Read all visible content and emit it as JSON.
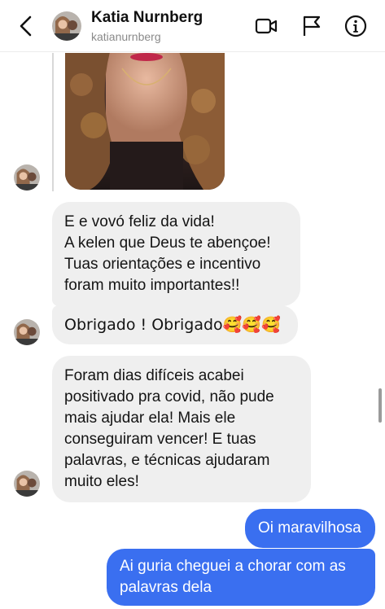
{
  "header": {
    "name": "Katia Nurnberg",
    "username": "katianurnberg",
    "icons": [
      "back-chevron-icon",
      "video-call-icon",
      "flag-icon",
      "info-icon"
    ]
  },
  "messages": {
    "incoming_1": [
      "E e vovó feliz da vida!",
      "A kelen que Deus te abençoe!",
      "Tuas orientações e incentivo",
      "foram muito importantes!!"
    ],
    "incoming_2": "Obrigado  ! Obrigado🥰🥰🥰",
    "incoming_3": [
      "Foram dias difíceis   acabei",
      "positivado pra covid,  não pude",
      "mais ajudar ela! Mais ele",
      "conseguiram vencer! E tuas",
      "palavras, e técnicas ajudaram",
      "muito eles!"
    ],
    "outgoing_1": "Oi maravilhosa",
    "outgoing_2": [
      "Ai guria cheguei a chorar com as",
      "palavras dela"
    ]
  },
  "colors": {
    "outgoing_bubble": "#3a6ff0",
    "incoming_bubble": "#efefef"
  }
}
